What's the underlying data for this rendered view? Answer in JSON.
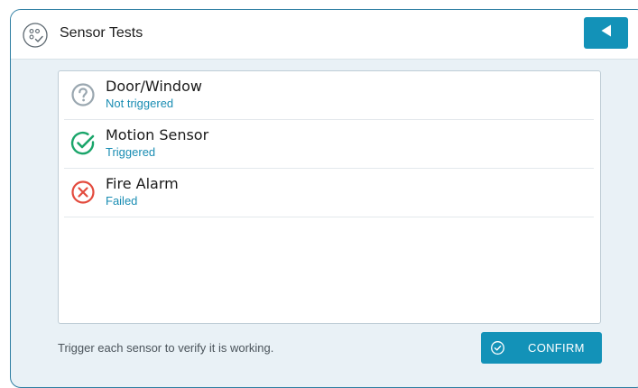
{
  "header": {
    "title": "Sensor Tests",
    "icon": "sensor-check-icon",
    "back_icon": "triangle-left-icon"
  },
  "sensors": [
    {
      "name": "Door/Window",
      "status": "Not triggered",
      "icon": "question-circle-icon",
      "icon_color": "#9aa7b0"
    },
    {
      "name": "Motion Sensor",
      "status": "Triggered",
      "icon": "check-circle-icon",
      "icon_color": "#1aa56a"
    },
    {
      "name": "Fire Alarm",
      "status": "Failed",
      "icon": "x-circle-icon",
      "icon_color": "#e34b3e"
    }
  ],
  "footer": {
    "hint": "Trigger each sensor to verify it is working.",
    "confirm_label": "CONFIRM",
    "confirm_icon": "check-circle-outline-icon"
  },
  "colors": {
    "accent": "#1392b8",
    "status_text": "#1a8db3",
    "background": "#e9f1f6"
  }
}
